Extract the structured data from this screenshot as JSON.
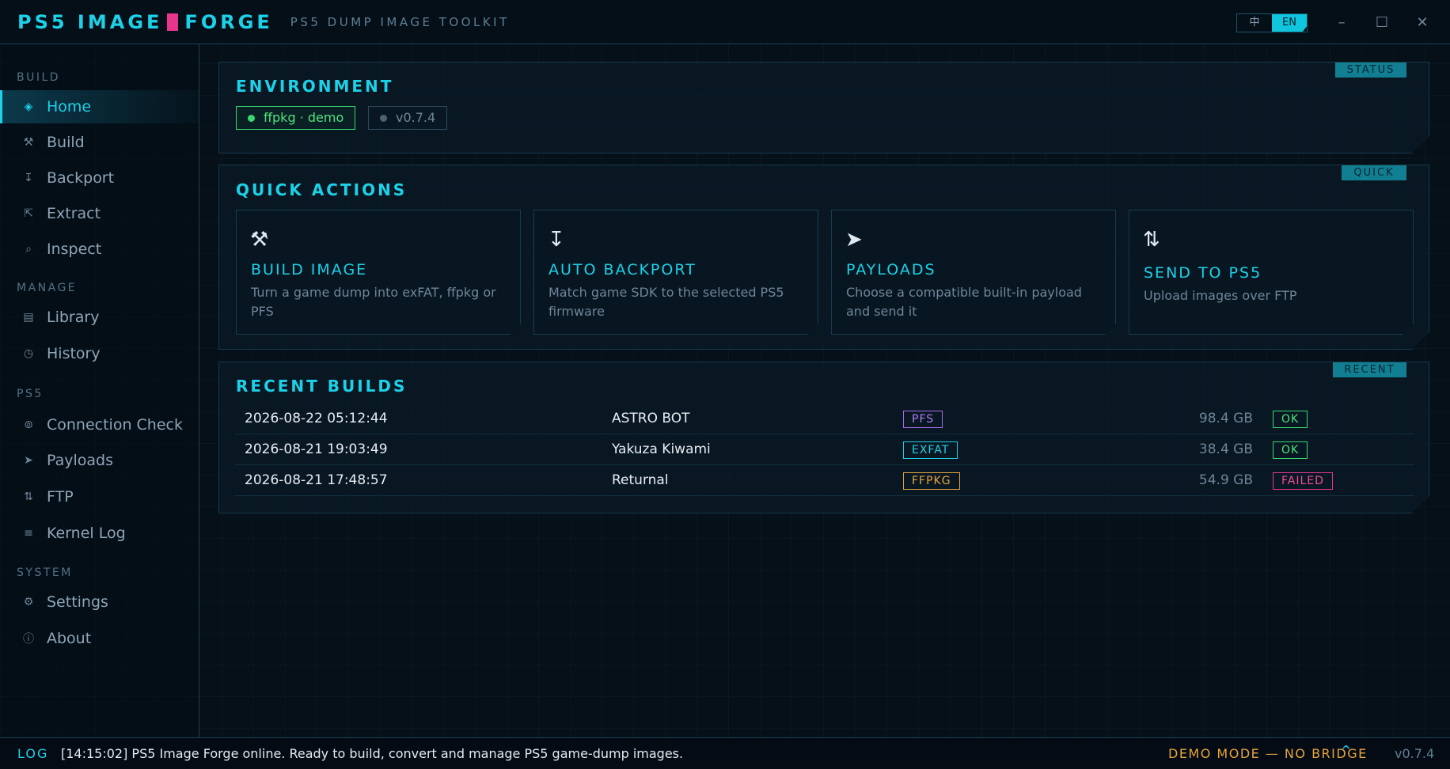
{
  "app": {
    "logo_left": "PS5 IMAGE",
    "logo_right": "FORGE",
    "subtitle": "PS5 DUMP IMAGE TOOLKIT",
    "lang_zh": "中",
    "lang_en": "EN",
    "win_min": "–",
    "win_max": "☐",
    "win_close": "✕"
  },
  "sidebar": {
    "sections": [
      "BUILD",
      "MANAGE",
      "PS5",
      "SYSTEM"
    ],
    "items": [
      {
        "label": "Home",
        "icon": "◈"
      },
      {
        "label": "Build",
        "icon": "⚒"
      },
      {
        "label": "Backport",
        "icon": "↧"
      },
      {
        "label": "Extract",
        "icon": "⇱"
      },
      {
        "label": "Inspect",
        "icon": "⌕"
      },
      {
        "label": "Library",
        "icon": "▤"
      },
      {
        "label": "History",
        "icon": "◷"
      },
      {
        "label": "Connection Check",
        "icon": "⊚"
      },
      {
        "label": "Payloads",
        "icon": "➤"
      },
      {
        "label": "FTP",
        "icon": "⇅"
      },
      {
        "label": "Kernel Log",
        "icon": "≡"
      },
      {
        "label": "Settings",
        "icon": "⚙"
      },
      {
        "label": "About",
        "icon": "ⓘ"
      }
    ]
  },
  "environment": {
    "tag": "STATUS",
    "title": "ENVIRONMENT",
    "chip_mode": "ffpkg · demo",
    "chip_version": "v0.7.4"
  },
  "quick": {
    "tag": "QUICK",
    "title": "QUICK ACTIONS",
    "cards": [
      {
        "icon": "⚒",
        "title": "BUILD IMAGE",
        "desc": "Turn a game dump into exFAT, ffpkg or PFS"
      },
      {
        "icon": "↧",
        "title": "AUTO BACKPORT",
        "desc": "Match game SDK to the selected PS5 firmware"
      },
      {
        "icon": "➤",
        "title": "PAYLOADS",
        "desc": "Choose a compatible built-in payload and send it"
      },
      {
        "icon": "⇅",
        "title": "SEND TO PS5",
        "desc": "Upload images over FTP"
      }
    ]
  },
  "recent": {
    "tag": "RECENT",
    "title": "RECENT BUILDS",
    "rows": [
      {
        "date": "2026-08-22 05:12:44",
        "game": "ASTRO BOT",
        "format": "PFS",
        "size": "98.4 GB",
        "status": "OK"
      },
      {
        "date": "2026-08-21 19:03:49",
        "game": "Yakuza Kiwami",
        "format": "EXFAT",
        "size": "38.4 GB",
        "status": "OK"
      },
      {
        "date": "2026-08-21 17:48:57",
        "game": "Returnal",
        "format": "FFPKG",
        "size": "54.9 GB",
        "status": "FAILED"
      }
    ]
  },
  "log": {
    "tag": "LOG",
    "message": "[14:15:02] PS5 Image Forge online. Ready to build, convert and manage PS5 game-dump images.",
    "demo": "DEMO MODE — NO BRIDGE",
    "caret": "^",
    "version": "v0.7.4"
  },
  "colors": {
    "accent": "#1cd1e8",
    "pink": "#e8368f",
    "ok": "#39d86e",
    "failed": "#e8368f",
    "pfs": "#a66ce8",
    "exfat": "#1cd1e8",
    "ffpkg": "#e5a43c",
    "demo": "#e5a43c"
  }
}
